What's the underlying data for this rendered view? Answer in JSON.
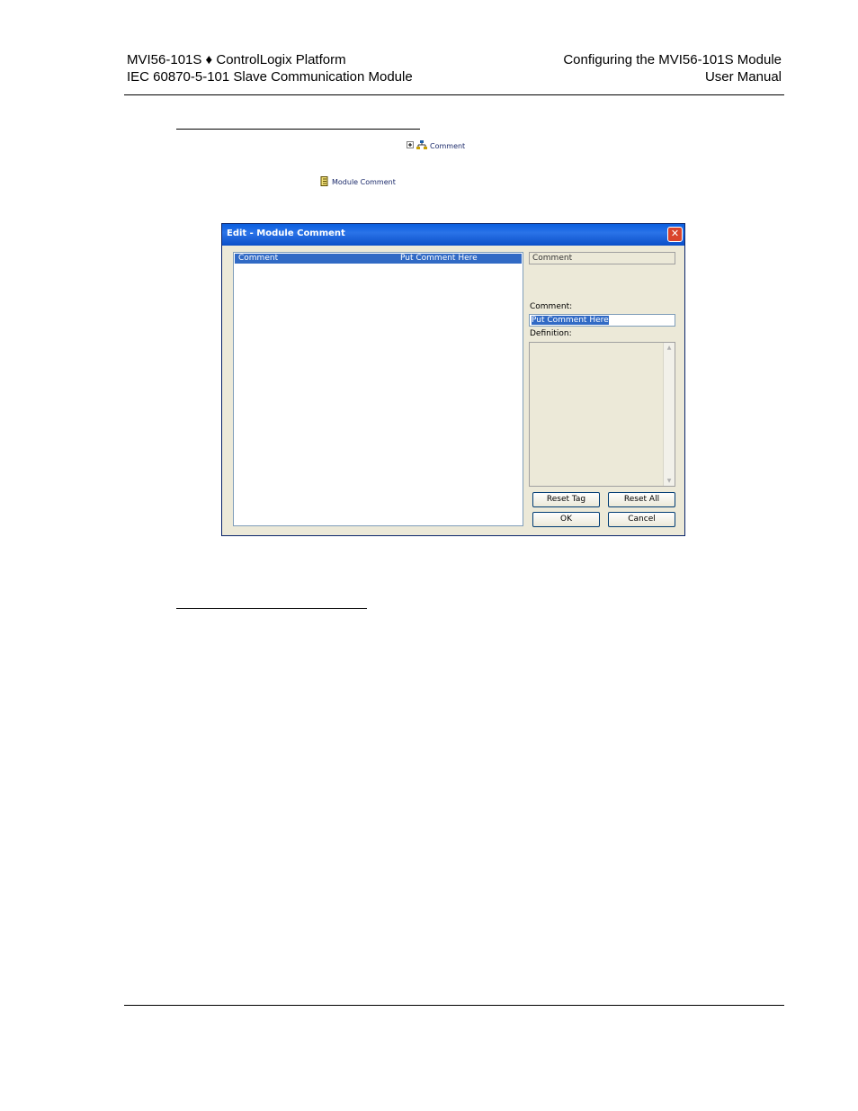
{
  "header": {
    "left_line1": "MVI56-101S ♦ ControlLogix Platform",
    "left_line2": "IEC 60870-5-101 Slave Communication Module",
    "right_line1": "Configuring the MVI56-101S Module",
    "right_line2": "User Manual"
  },
  "tree_items": {
    "comment_label": "Comment",
    "module_comment_label": "Module Comment"
  },
  "dialog": {
    "title": "Edit - Module Comment",
    "close_glyph": "✕",
    "list_row": {
      "name": "Comment",
      "value": "Put Comment Here"
    },
    "tag_name": "Comment",
    "comment_label": "Comment:",
    "comment_value": "Put Comment Here",
    "definition_label": "Definition:",
    "buttons": {
      "reset_tag": "Reset Tag",
      "reset_all": "Reset All",
      "ok": "OK",
      "cancel": "Cancel"
    }
  }
}
